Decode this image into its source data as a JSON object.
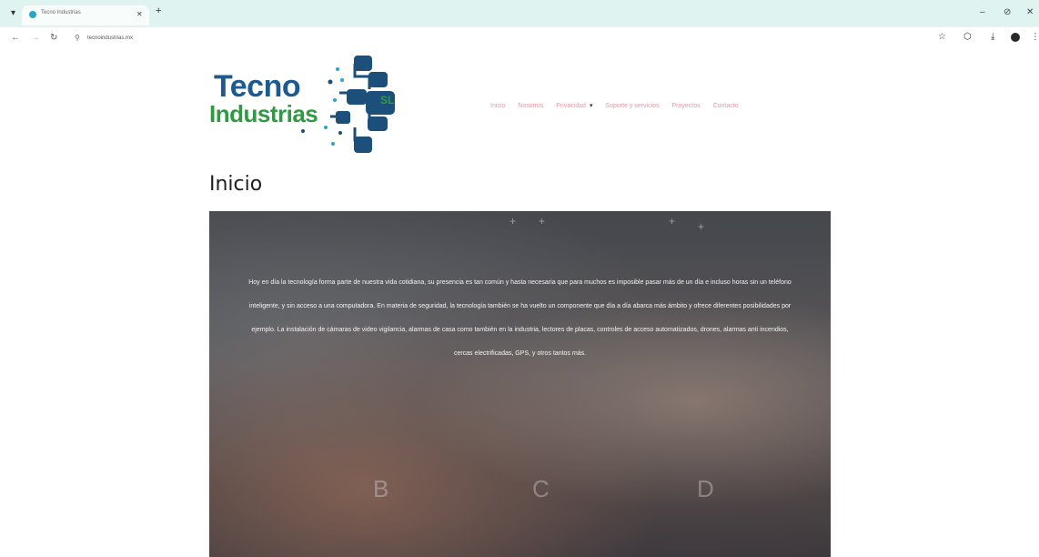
{
  "browser": {
    "tab_title": "Tecno Industrias",
    "url": "tecnoindustrias.mx",
    "new_tab": "+",
    "window_controls": {
      "minimize": "–",
      "restore": "⊘",
      "close": "✕"
    },
    "icons": [
      "back-icon",
      "forward-icon",
      "reload-icon",
      "site-info-icon",
      "bookmark-star-icon",
      "extensions-icon",
      "download-icon",
      "profile-icon",
      "menu-icon"
    ]
  },
  "logo": {
    "line1": "Tecno",
    "line2": "Industrias",
    "badge": "SL",
    "colors": {
      "blue": "#1c5a8f",
      "green": "#2e9b42"
    }
  },
  "nav": {
    "items": [
      "Inicio",
      "Nosotros",
      "Privacidad",
      "Soporte y servicios",
      "Proyectos",
      "Contacto"
    ],
    "dropdown_marker": "▾",
    "color": "#e59aa2"
  },
  "page": {
    "title": "Inicio",
    "hero_text": "Hoy en día la tecnología forma parte de nuestra vida cotidiana, su presencia es tan común y hasta necesaria que para muchos es imposible pasar más de un día e incluso horas sin un teléfono inteligente, y sin acceso a una computadora. En materia de seguridad, la tecnología también se ha vuelto un componente que día a día abarca más ámbito y ofrece diferentes posibilidades por ejemplo. La instalación de cámaras de video vigilancia, alarmas de casa como también en la industria, lectores de placas, controles de acceso automatizados, drones, alarmas anti incendios, cercas electrificadas, GPS, y otros tantos más.",
    "hero_letters": [
      "B",
      "C",
      "D"
    ]
  }
}
